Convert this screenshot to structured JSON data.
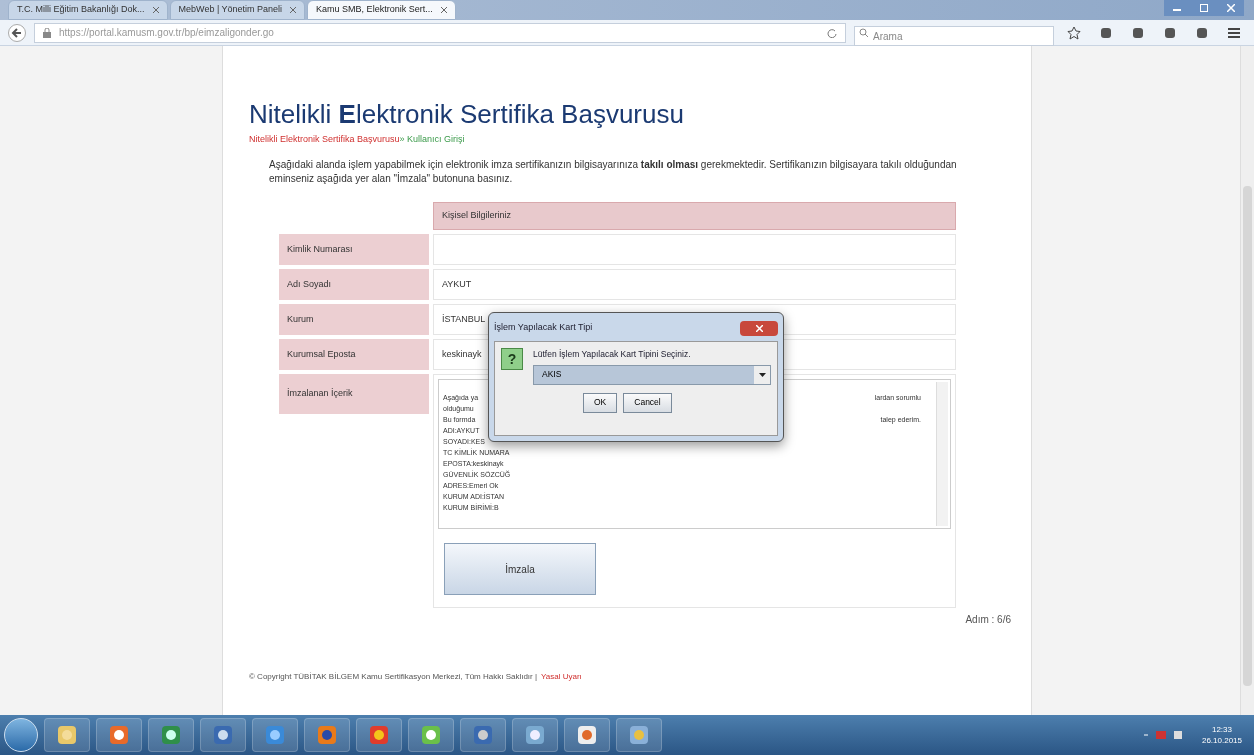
{
  "browser": {
    "tabs": [
      {
        "label": "T.C. Milli Eğitim Bakanlığı Dok...",
        "selected": false
      },
      {
        "label": "MebWeb | Yönetim Paneli",
        "selected": false
      },
      {
        "label": "Kamu SMB, Elektronik Sert...",
        "selected": true
      }
    ],
    "url": "https://portal.kamusm.gov.tr/bp/eimzaligonder.go",
    "search_placeholder": "Arama"
  },
  "page": {
    "title": "Nitelikli **E**lektronik Sertifika Başvurusu",
    "breadcrumb": [
      {
        "label": "Nitelikli Elektronik Sertifika Başvurusu",
        "kind": "link"
      },
      {
        "label": " » Kullanıcı Girişi",
        "kind": "current"
      }
    ],
    "intro": "Aşağıdaki alanda işlem yapabilmek için elektronik imza sertifikanızın bilgisayarınıza **takılı olması** gerekmektedir. Sertifikanızın bilgisayara takılı olduğundan eminseniz aşağıda yer alan \"İmzala\" butonuna basınız.",
    "section_header": "Kişisel Bilgileriniz",
    "rows": [
      {
        "label": "Kimlik Numarası"
      },
      {
        "label": "Adı Soyadı",
        "value": "AYKUT"
      },
      {
        "label": "Kurum",
        "value": "İSTANBUL"
      },
      {
        "label": "Kurumsal Eposta",
        "value": "keskinayk"
      }
    ],
    "signed_label": "İmzalanan İçerik",
    "signed_lines": [
      {
        "left": "Aşağıda ya",
        "right": "lardan sorumlu"
      },
      {
        "left": "olduğumu"
      },
      {
        "left": "Bu formda",
        "right": "talep ederim."
      },
      {
        "left": "ADI:AYKUT"
      },
      {
        "left": "SOYADI:KES"
      },
      {
        "left": "TC KİMLİK NUMARA"
      },
      {
        "left": "EPOSTA:keskinayk"
      },
      {
        "left": "GÜVENLİK SÖZCÜĞ"
      },
      {
        "left": "ADRES:Emeri Ok"
      },
      {
        "left": "KURUM ADI:İSTAN"
      },
      {
        "left": "KURUM BİRİMİ:B"
      }
    ],
    "sign_button": "İmzala",
    "step": "Adım : 6/6",
    "copyright": "© Copyright TÜBİTAK BİLGEM Kamu Sertifikasyon Merkezi, Tüm Hakkı Saklıdır |",
    "legal_link": "Yasal Uyarı"
  },
  "dialog": {
    "icon_glyph": "?",
    "title": "İşlem Yapılacak Kart Tipi",
    "prompt": "Lütfen İşlem Yapılacak Kart Tipini Seçiniz.",
    "select_value": "AKIS",
    "buttons": [
      "OK",
      "Cancel"
    ]
  },
  "taskbar": {
    "time": "12:33",
    "date": "26.10.2015"
  }
}
